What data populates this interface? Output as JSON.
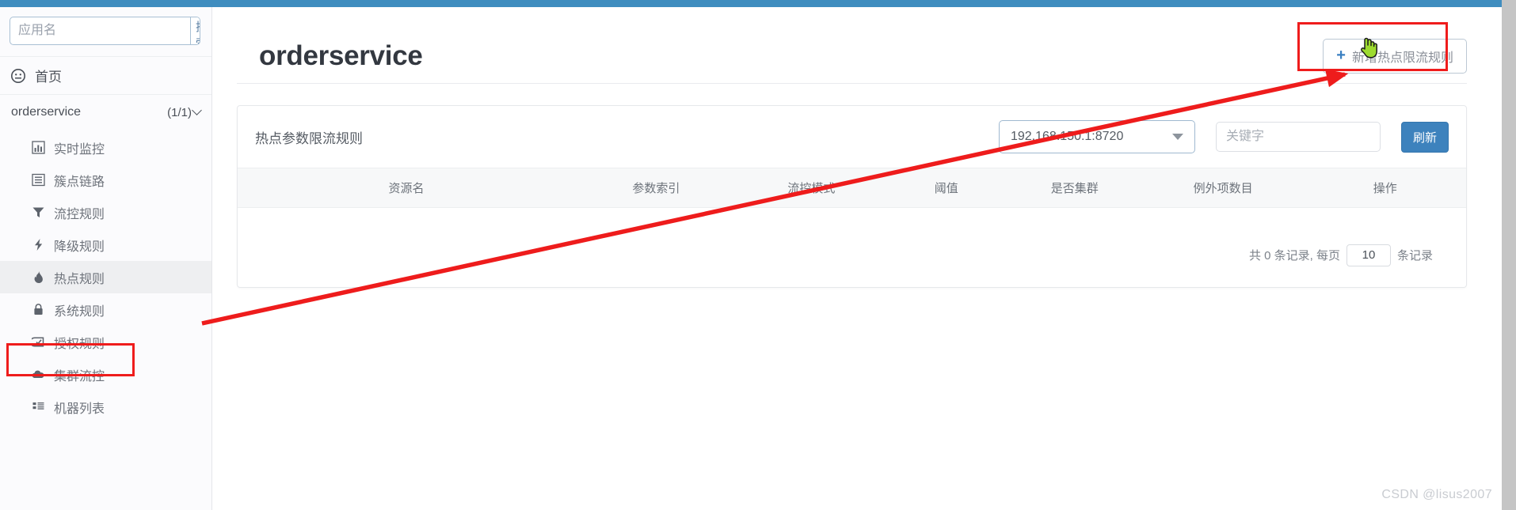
{
  "topbar": {
    "color": "#3f8dbf"
  },
  "sidebar": {
    "search": {
      "placeholder": "应用名",
      "value": "",
      "button_label": "搜索"
    },
    "home": {
      "label": "首页",
      "icon": "dashboard-icon"
    },
    "app": {
      "name": "orderservice",
      "count": "(1/1)",
      "icon": "chevron-down-icon"
    },
    "items": [
      {
        "label": "实时监控",
        "icon": "bar-chart-icon",
        "active": false
      },
      {
        "label": "簇点链路",
        "icon": "list-view-icon",
        "active": false
      },
      {
        "label": "流控规则",
        "icon": "filter-icon",
        "active": false
      },
      {
        "label": "降级规则",
        "icon": "bolt-icon",
        "active": false
      },
      {
        "label": "热点规则",
        "icon": "fire-icon",
        "active": true
      },
      {
        "label": "系统规则",
        "icon": "lock-icon",
        "active": false
      },
      {
        "label": "授权规则",
        "icon": "check-badge-icon",
        "active": false
      },
      {
        "label": "集群流控",
        "icon": "cloud-icon",
        "active": false
      },
      {
        "label": "机器列表",
        "icon": "grid-list-icon",
        "active": false
      }
    ]
  },
  "main": {
    "page_title": "orderservice",
    "add_button": {
      "label": "新增热点限流规则",
      "icon": "plus-icon"
    },
    "card": {
      "title": "热点参数限流规则",
      "machine_select": {
        "value": "192.168.150.1:8720",
        "icon": "caret-down-icon"
      },
      "keyword_input": {
        "placeholder": "关键字",
        "value": ""
      },
      "refresh_button": "刷新",
      "table": {
        "columns": [
          "资源名",
          "参数索引",
          "流控模式",
          "阈值",
          "是否集群",
          "例外项数目",
          "操作"
        ],
        "rows": []
      },
      "pager": {
        "prefix": "共 0 条记录, 每页",
        "page_size": "10",
        "suffix": "条记录"
      }
    }
  },
  "annotations": {
    "highlight_color": "#ef1c1c",
    "boxes": [
      "热点规则",
      "新增热点限流规则"
    ],
    "arrow": {
      "from": "热点规则",
      "to": "新增热点限流规则"
    }
  },
  "watermark": "CSDN @lisus2007"
}
